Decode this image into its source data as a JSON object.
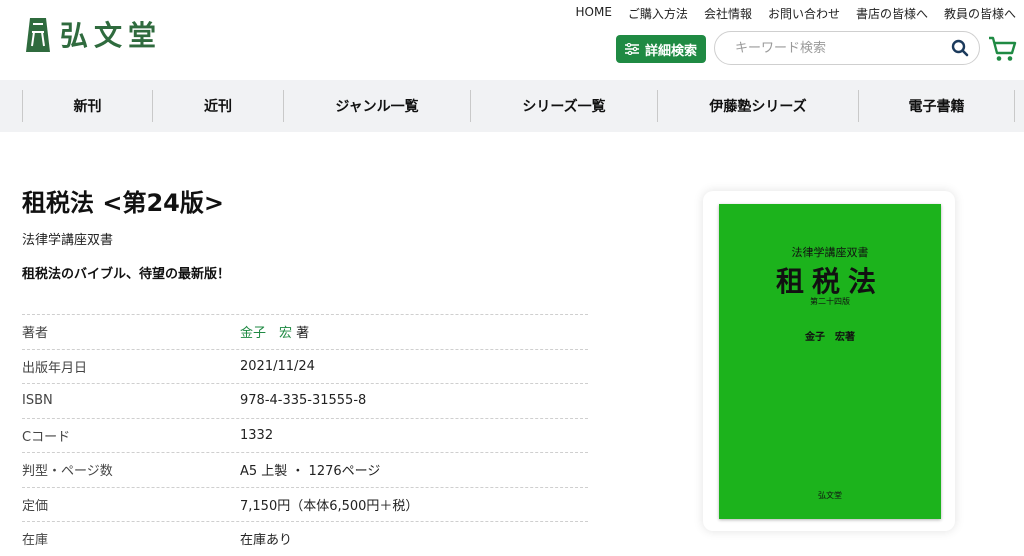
{
  "brand": {
    "name": "弘文堂",
    "color": "#2f6b3e"
  },
  "top_links": [
    "HOME",
    "ご購入方法",
    "会社情報",
    "お問い合わせ",
    "書店の皆様へ",
    "教員の皆様へ"
  ],
  "search": {
    "detail_label": "詳細検索",
    "placeholder": "キーワード検索",
    "accent": "#1f8a43"
  },
  "nav": [
    "新刊",
    "近刊",
    "ジャンル一覧",
    "シリーズ一覧",
    "伊藤塾シリーズ",
    "電子書籍"
  ],
  "book": {
    "title": "租税法 <第24版>",
    "series": "法律学講座双書",
    "catchphrase": "租税法のバイブル、待望の最新版！",
    "info": [
      {
        "label": "著者",
        "author": "金子　宏",
        "suffix": " 著"
      },
      {
        "label": "出版年月日",
        "value": "2021/11/24"
      },
      {
        "label": "ISBN",
        "value": "978-4-335-31555-8"
      },
      {
        "label": "Cコード",
        "value": "1332"
      },
      {
        "label": "判型・ページ数",
        "value": "A5 上製 ・ 1276ページ"
      },
      {
        "label": "定価",
        "value": "7,150円（本体6,500円＋税）"
      },
      {
        "label": "在庫",
        "value": "在庫あり"
      }
    ],
    "cover": {
      "series": "法律学講座双書",
      "title": "租税法",
      "edition": "第二十四版",
      "author": "金子　宏著",
      "publisher": "弘文堂",
      "color": "#1cb31c"
    }
  }
}
